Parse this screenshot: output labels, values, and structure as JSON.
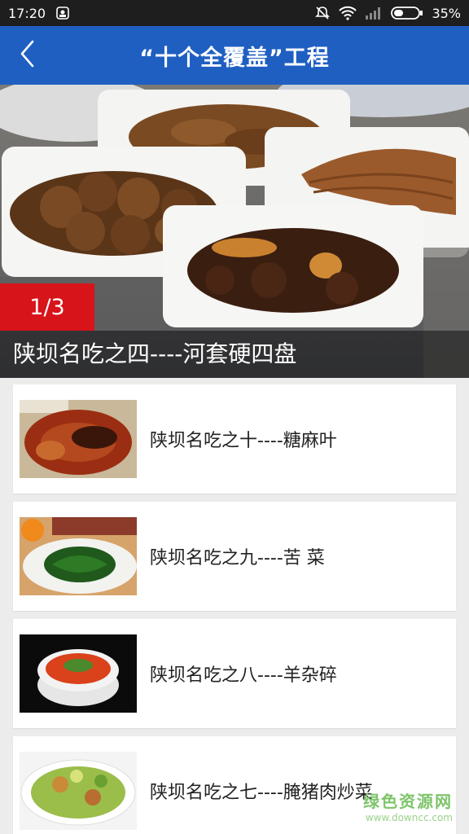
{
  "status_bar": {
    "time": "17:20",
    "battery": "35%",
    "icons": [
      "screenshot-icon",
      "mute-icon",
      "wifi-icon",
      "signal-icon",
      "battery-icon"
    ]
  },
  "header": {
    "title": "“十个全覆盖”工程",
    "back_icon": "chevron-left-icon",
    "color": "#1f5fc2"
  },
  "banner": {
    "index": "1/3",
    "caption": "陕坝名吃之四----河套硬四盘",
    "index_color": "#d7141a"
  },
  "list": {
    "items": [
      {
        "title": "陕坝名吃之十----糖麻叶"
      },
      {
        "title": "陕坝名吃之九----苦 菜"
      },
      {
        "title": "陕坝名吃之八----羊杂碎"
      },
      {
        "title": "陕坝名吃之七----腌猪肉炒菜"
      }
    ]
  },
  "watermark": {
    "line1": "绿色资源网",
    "line2": "www.downcc.com"
  }
}
